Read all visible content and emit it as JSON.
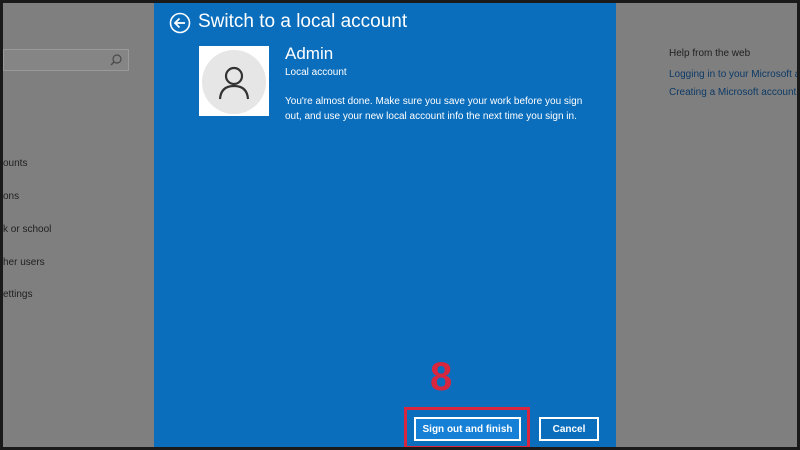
{
  "background": {
    "sidebar": {
      "items": [
        "ounts",
        "ons",
        "k or school",
        "her users",
        "ettings"
      ]
    },
    "help": {
      "title": "Help from the web",
      "links": [
        "Logging in to your Microsoft ac",
        "Creating a Microsoft account"
      ]
    }
  },
  "dialog": {
    "title": "Switch to a local account",
    "account_name": "Admin",
    "account_type": "Local account",
    "message": "You're almost done. Make sure you save your work before you sign out, and use your new local account info the next time you sign in.",
    "buttons": {
      "primary": "Sign out and finish",
      "cancel": "Cancel"
    }
  },
  "annotation": {
    "step": "8",
    "color": "#d7263d"
  },
  "colors": {
    "dialog_bg": "#0a6ebd",
    "overlay": "#7f7f7f"
  },
  "icons": {
    "back": "back-arrow-icon",
    "search": "search-icon",
    "avatar": "user-avatar-icon"
  }
}
